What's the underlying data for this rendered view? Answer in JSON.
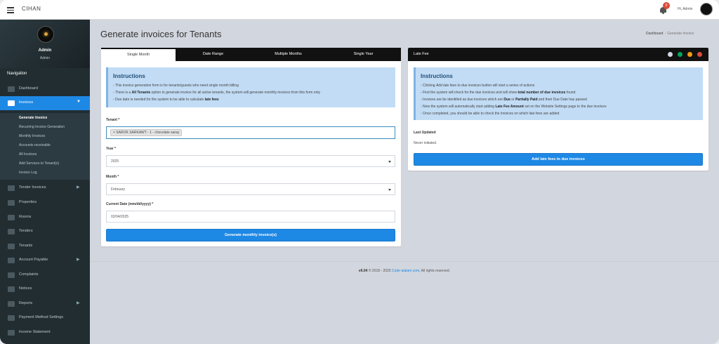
{
  "topbar": {
    "brand": "CIHAN",
    "notification_count": "0",
    "greeting": "Hi, Admin"
  },
  "sidebar": {
    "user_name": "Admin",
    "user_role": "Admin",
    "nav_header": "Navigation",
    "items": [
      {
        "label": "Dashboard",
        "icon": "home-icon"
      },
      {
        "label": "Invoices",
        "icon": "credit-card-icon",
        "active": true
      },
      {
        "label": "Tender Invoices",
        "icon": "table-icon"
      },
      {
        "label": "Properties",
        "icon": "building-icon"
      },
      {
        "label": "Rooms",
        "icon": "building-icon"
      },
      {
        "label": "Tenders",
        "icon": "id-card-icon"
      },
      {
        "label": "Tenants",
        "icon": "users-icon"
      },
      {
        "label": "Account Payable",
        "icon": "money-icon"
      },
      {
        "label": "Complaints",
        "icon": "warning-icon"
      },
      {
        "label": "Notices",
        "icon": "bullhorn-icon"
      },
      {
        "label": "Reports",
        "icon": "file-icon"
      },
      {
        "label": "Payment Method Settings",
        "icon": "cogs-icon"
      },
      {
        "label": "Income Statement",
        "icon": "list-icon"
      }
    ],
    "invoice_submenu": [
      "Generate Invoice",
      "Recurring Invoice Generation",
      "Monthly Invoices",
      "Accounts receivable",
      "All Invoices",
      "Add Services to Tenant(s)",
      "Invoice Log"
    ]
  },
  "page": {
    "title": "Generate invoices for Tenants",
    "breadcrumb": [
      "Dashboard",
      "Generate Invoice"
    ]
  },
  "left_panel": {
    "tabs": [
      "Single Month",
      "Date Range",
      "Multiple Months",
      "Single Year"
    ],
    "instructions_title": "Instructions",
    "instructions": {
      "line1": "- This invoice generation form is for tenants/guests who need single month billing",
      "line2_pre": "- There is a ",
      "line2_bold": "All Tenants",
      "line2_post": " option to generate invoice for all active tenants, the system will generate monthly invoices from this form only",
      "line3_pre": "- Due date is needed for the system to be able to calculate ",
      "line3_bold": "late fees"
    },
    "tenant_label": "Tenant *",
    "tenant_value": "× SAROK SARKAWT - 1 - chocolate saray",
    "year_label": "Year *",
    "year_value": "2025",
    "month_label": "Month *",
    "month_value": "February",
    "date_label": "Current Date (mm/dd/yyyy) *",
    "date_value": "02/04/2025",
    "submit_label": "Generate monthly invoice(s)"
  },
  "right_panel": {
    "title": "Late Fee",
    "instructions_title": "Instructions",
    "instructions": {
      "l1_pre": "- Clicking ",
      "l1_italic": "Add late fees to due invoices",
      "l1_post": " button will start a series of actions",
      "l2_pre": "- First the system will check for the due invoices and will show ",
      "l2_bold": "total number of due invoices",
      "l2_post": " found",
      "l3_pre": "- Invoices are be identified as due invoices which are ",
      "l3_bold1": "Due",
      "l3_mid": " or ",
      "l3_bold2": "Partially Paid",
      "l3_post": " and their Due Date has passed",
      "l4_pre": "- Now the system will automatically start adding ",
      "l4_bold": "Late Fee Amount",
      "l4_post": " set on the Website Settings page to the due invoices",
      "l5": "- Once completed, you should be able to check the invoices on which late fees are added"
    },
    "last_updated_label": "Last Updated",
    "last_updated_value": "Never initiated.",
    "button_label": "Add late fees to due invoices",
    "header_button_colors": [
      "#d2d6de",
      "#00a65a",
      "#f39c12",
      "#dd4b39"
    ]
  },
  "footer": {
    "version": "v6.04",
    "copyright": " © 2018 - 2025 ",
    "link": "Code-alalam.com",
    "rights": ", All rights reserved."
  },
  "colors": {
    "accent": "#1e88e5",
    "sidebar_bg": "#222d32",
    "callout_bg": "#c2dcf5"
  }
}
